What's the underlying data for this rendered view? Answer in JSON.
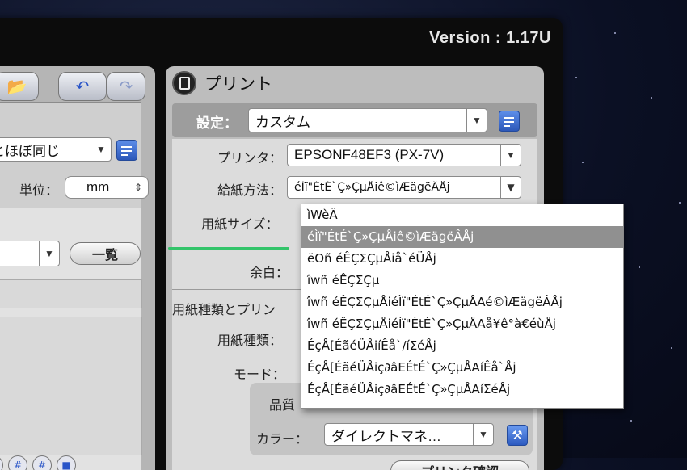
{
  "version": "Version : 1.17U",
  "left_panel": {
    "dropdown_value": "とほぼ同じ",
    "unit_label": "単位：",
    "unit_value": "mm",
    "list_button": "一覧"
  },
  "print_panel": {
    "title": "プリント",
    "settings_label": "設定：",
    "settings_value": "カスタム",
    "printer_label": "プリンタ：",
    "printer_value": "EPSONF48EF3 (PX-7V)",
    "feed_label": "給紙方法：",
    "feed_value": "éÌï\"ÉtÉ`Ç»ÇµÅiê©ìÆägëÂÅj",
    "paper_size_label": "用紙サイズ：",
    "margin_label": "余白：",
    "section_label": "用紙種類とプリン",
    "paper_type_label": "用紙種類：",
    "mode_label": "モード：",
    "quality_label": "品質",
    "color_label": "カラー：",
    "color_value": "ダイレクトマネ…",
    "confirm_button": "プリンタ確認"
  },
  "menu": {
    "items": [
      "ìWèÄ",
      "éÌï\"ÉtÉ`Ç»ÇµÅiê©ìÆägëÂÅj",
      "ëOñ éÊÇΣÇµÅiå`éÜÅj",
      "îwñ éÊÇΣÇµ",
      "îwñ éÊÇΣÇµÅiéÌï\"ÉtÉ`Ç»ÇµÅAé©ìÆägëÂÅj",
      "îwñ éÊÇΣÇµÅiéÌï\"ÉtÉ`Ç»ÇµÅAå¥ê°à€éùÅj",
      "ÉçÅ[ÉãéÜÅiíÊå`/íΣéÅj",
      "ÉçÅ[ÉãéÜÅiç∂âEÉtÉ`Ç»ÇµÅAíÊå`Åj",
      "ÉçÅ[ÉãéÜÅiç∂âEÉtÉ`Ç»ÇµÅAíΣéÅj"
    ],
    "selected_index": 1
  }
}
